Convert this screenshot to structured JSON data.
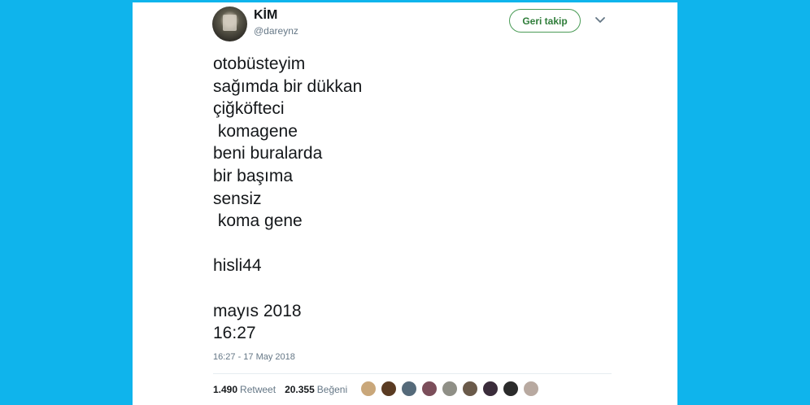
{
  "user": {
    "name": "KİM",
    "handle": "@dareynz"
  },
  "follow_button_label": "Geri takip",
  "menu_icon": "chevron-down-icon",
  "tweet_lines": [
    "otobüsteyim",
    "sağımda bir dükkan",
    "çiğköfteci",
    " komagene",
    "beni buralarda",
    "bir başıma",
    "sensiz",
    " koma gene",
    "",
    "hisli44",
    "",
    "mayıs 2018",
    "16:27"
  ],
  "timestamp": "16:27 - 17 May 2018",
  "stats": {
    "retweets": "1.490",
    "retweets_label": "Retweet",
    "likes": "20.355",
    "likes_label": "Beğeni"
  },
  "colors": {
    "background": "#0fb4ec",
    "follow_green": "#2f7d3a"
  },
  "likers": [
    {
      "color": "#c9a77a"
    },
    {
      "color": "#5a3b22"
    },
    {
      "color": "#556a7a"
    },
    {
      "color": "#7b4e5a"
    },
    {
      "color": "#8f8f86"
    },
    {
      "color": "#6a5a4a"
    },
    {
      "color": "#3a2c3a"
    },
    {
      "color": "#2b2b2b"
    },
    {
      "color": "#b8a9a0"
    }
  ]
}
